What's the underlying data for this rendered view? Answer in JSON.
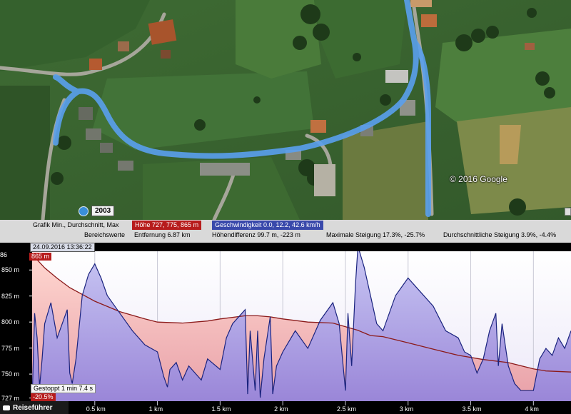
{
  "map": {
    "copyright": "© 2016 Google",
    "imagery_year": "2003",
    "colors": {
      "route": "#5aa0ee",
      "grass": "#3f6b34"
    }
  },
  "info": {
    "graph_label": "Grafik  Min., Durchschnitt, Max",
    "height_label": "Höhe  727, 775, 865 m",
    "speed_label": "Geschwindigkeit  0.0, 12.2, 42.6 km/h",
    "range_label": "Bereichswerte",
    "distance_label": "Entfernung  6.87 km",
    "height_diff_label": "Höhendifferenz  99.7 m, -223 m",
    "max_slope_label": "Maximale Steigung  17.3%, -25.7%",
    "avg_slope_label": "Durchschnittliche Steigung  3.9%, -4.4%"
  },
  "chart_overlay": {
    "date": "24.09.2016 13:36:22",
    "max_height": "865 m",
    "stopped": "Gestoppt  1 min 7.4 s",
    "grade": "-20.5%",
    "top_left_fragment": "86",
    "tour_guide": "Reiseführer"
  },
  "chart_data": {
    "type": "area",
    "xlabel": "",
    "ylabel": "",
    "x_unit": "km",
    "xlim": [
      0,
      4.3
    ],
    "y_height_range": [
      724,
      868
    ],
    "y_speed_range": [
      0,
      42.6
    ],
    "y_ticks": [
      {
        "value": 850,
        "label": "850 m"
      },
      {
        "value": 825,
        "label": "825 m"
      },
      {
        "value": 800,
        "label": "800 m"
      },
      {
        "value": 775,
        "label": "775 m"
      },
      {
        "value": 750,
        "label": "750 m"
      },
      {
        "value": 727,
        "label": "727 m"
      }
    ],
    "x_ticks": [
      {
        "value": 0.5,
        "label": "0.5 km"
      },
      {
        "value": 1.0,
        "label": "1 km"
      },
      {
        "value": 1.5,
        "label": "1.5 km"
      },
      {
        "value": 2.0,
        "label": "2 km"
      },
      {
        "value": 2.5,
        "label": "2.5 km"
      },
      {
        "value": 3.0,
        "label": "3 km"
      },
      {
        "value": 3.5,
        "label": "3.5 km"
      },
      {
        "value": 4.0,
        "label": "4 km"
      }
    ],
    "series": [
      {
        "name": "Höhe",
        "color": "#8b1a1a",
        "x": [
          0,
          0.1,
          0.2,
          0.3,
          0.5,
          0.7,
          0.9,
          1.0,
          1.2,
          1.4,
          1.5,
          1.7,
          1.8,
          1.9,
          2.0,
          2.2,
          2.4,
          2.6,
          2.7,
          2.8,
          3.0,
          3.2,
          3.4,
          3.6,
          3.8,
          4.0,
          4.1,
          4.3
        ],
        "values": [
          865,
          852,
          842,
          833,
          820,
          810,
          803,
          800,
          799,
          801,
          803,
          806,
          806,
          805,
          803,
          800,
          799,
          792,
          787,
          786,
          780,
          774,
          768,
          764,
          761,
          755,
          753,
          752
        ]
      },
      {
        "name": "Geschwindigkeit",
        "color": "#1a237e",
        "x": [
          0,
          0.02,
          0.04,
          0.06,
          0.08,
          0.1,
          0.15,
          0.2,
          0.28,
          0.3,
          0.32,
          0.35,
          0.4,
          0.45,
          0.5,
          0.55,
          0.6,
          0.7,
          0.8,
          0.9,
          1.0,
          1.05,
          1.08,
          1.1,
          1.15,
          1.2,
          1.25,
          1.3,
          1.35,
          1.4,
          1.5,
          1.55,
          1.6,
          1.7,
          1.72,
          1.74,
          1.78,
          1.8,
          1.82,
          1.85,
          1.9,
          1.92,
          1.95,
          2.0,
          2.1,
          2.2,
          2.3,
          2.4,
          2.45,
          2.5,
          2.52,
          2.55,
          2.58,
          2.6,
          2.65,
          2.7,
          2.75,
          2.8,
          2.9,
          3.0,
          3.1,
          3.2,
          3.3,
          3.4,
          3.45,
          3.5,
          3.55,
          3.6,
          3.65,
          3.7,
          3.72,
          3.75,
          3.8,
          3.85,
          3.9,
          4.0,
          4.05,
          4.1,
          4.15,
          4.2,
          4.25,
          4.3
        ],
        "values": [
          0,
          25,
          18,
          4,
          12,
          22,
          28,
          18,
          26,
          8,
          5,
          12,
          30,
          36,
          39,
          35,
          30,
          25,
          20,
          16,
          14,
          7,
          4,
          9,
          11,
          6,
          10,
          8,
          6,
          12,
          9,
          18,
          22,
          26,
          2,
          20,
          3,
          20,
          1,
          12,
          24,
          2,
          10,
          14,
          20,
          15,
          23,
          28,
          22,
          3,
          25,
          10,
          33,
          44,
          38,
          30,
          22,
          20,
          30,
          35,
          31,
          27,
          20,
          18,
          14,
          13,
          8,
          12,
          20,
          25,
          10,
          22,
          10,
          5,
          3,
          3,
          12,
          15,
          13,
          18,
          15,
          20
        ]
      }
    ]
  }
}
